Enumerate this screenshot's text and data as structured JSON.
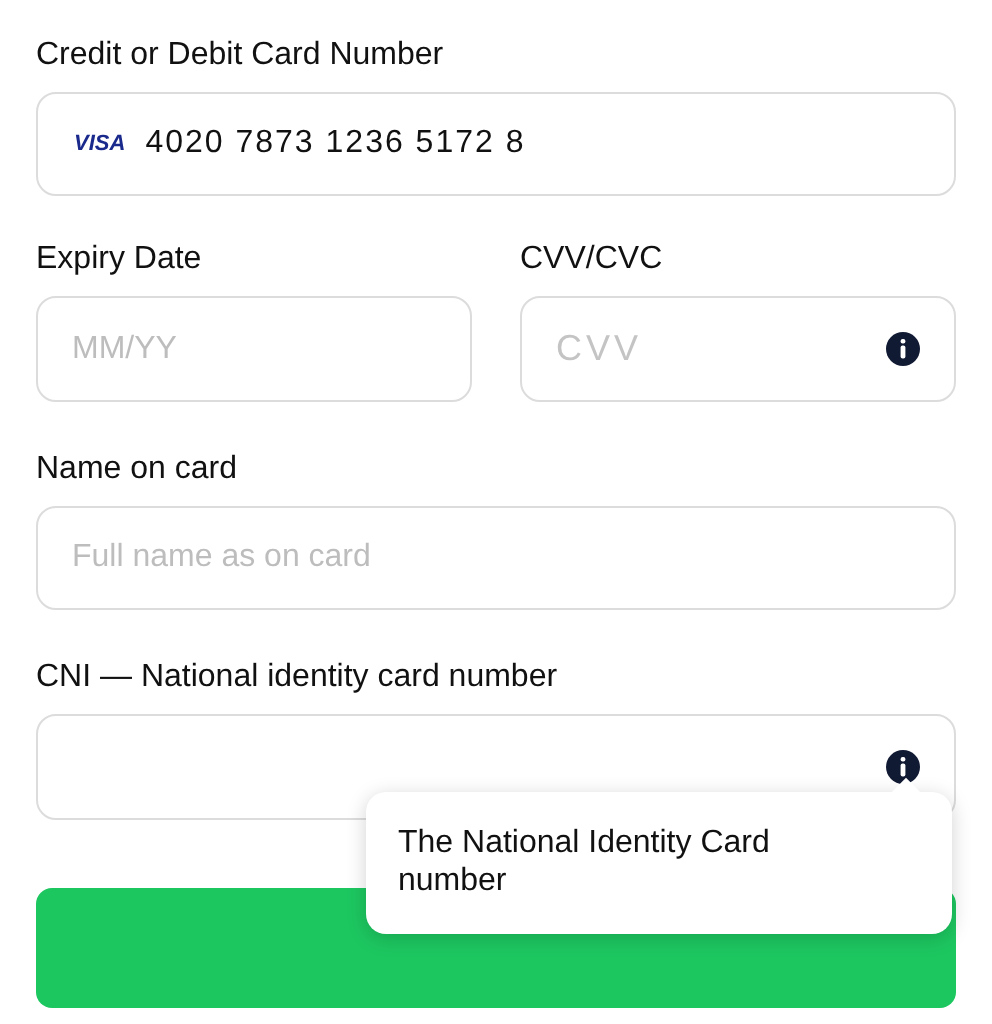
{
  "card_number": {
    "label": "Credit or Debit Card Number",
    "brand": "VISA",
    "value": "4020 7873 1236 5172 8"
  },
  "expiry": {
    "label": "Expiry Date",
    "placeholder": "MM/YY"
  },
  "cvv": {
    "label": "CVV/CVC",
    "placeholder": "CVV"
  },
  "name": {
    "label": "Name on card",
    "placeholder": "Full name as on card"
  },
  "cni": {
    "label": "CNI — National identity card number",
    "tooltip": "The National Identity Card number"
  },
  "pay_button": {
    "kind": "submit"
  }
}
